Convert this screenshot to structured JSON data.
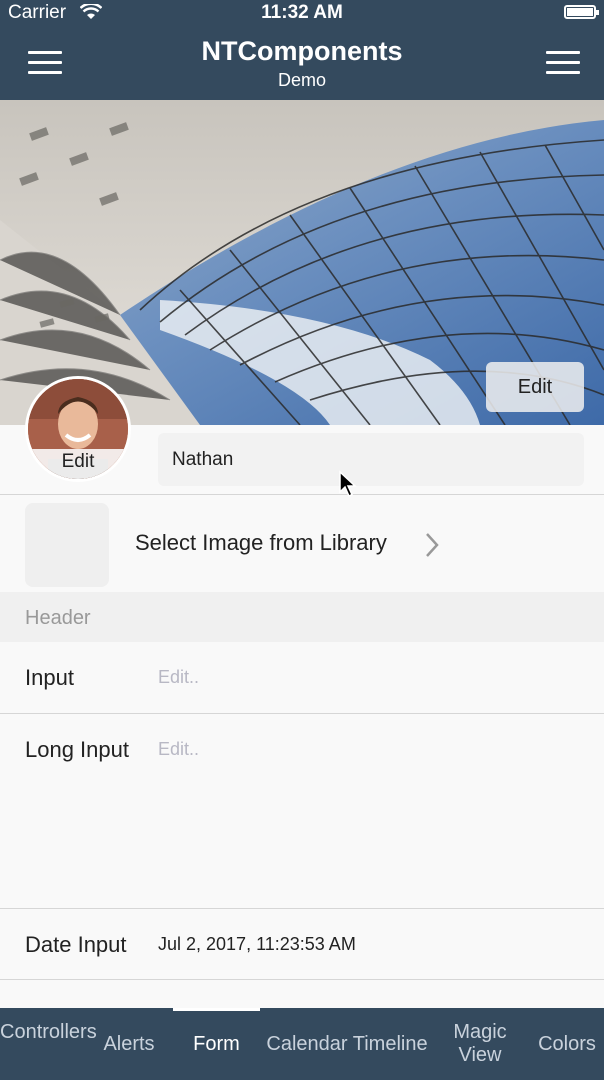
{
  "status_bar": {
    "carrier": "Carrier",
    "time": "11:32 AM"
  },
  "nav": {
    "title": "NTComponents",
    "subtitle": "Demo",
    "left_icon": "hamburger-menu-icon",
    "right_icon": "hamburger-menu-icon"
  },
  "profile": {
    "cover_edit_label": "Edit",
    "avatar_edit_label": "Edit",
    "name_value": "Nathan"
  },
  "image_picker": {
    "label": "Select Image from Library",
    "icon": "chevron-right-icon"
  },
  "form": {
    "header": "Header",
    "input_label": "Input",
    "input_placeholder": "Edit..",
    "long_input_label": "Long Input",
    "long_input_placeholder": "Edit..",
    "date_label": "Date Input",
    "date_value": "Jul 2, 2017, 11:23:53 AM"
  },
  "tabs": [
    {
      "label": "Controllers"
    },
    {
      "label": "Alerts"
    },
    {
      "label": "Form",
      "active": true
    },
    {
      "label": "Calendar Timeline"
    },
    {
      "label": "Magic View"
    },
    {
      "label": "Colors"
    }
  ],
  "colors": {
    "nav_background": "#344a5e",
    "page_background": "#f9f9f9",
    "tab_active": "#ffffff",
    "tab_inactive": "#c9d2dc"
  }
}
